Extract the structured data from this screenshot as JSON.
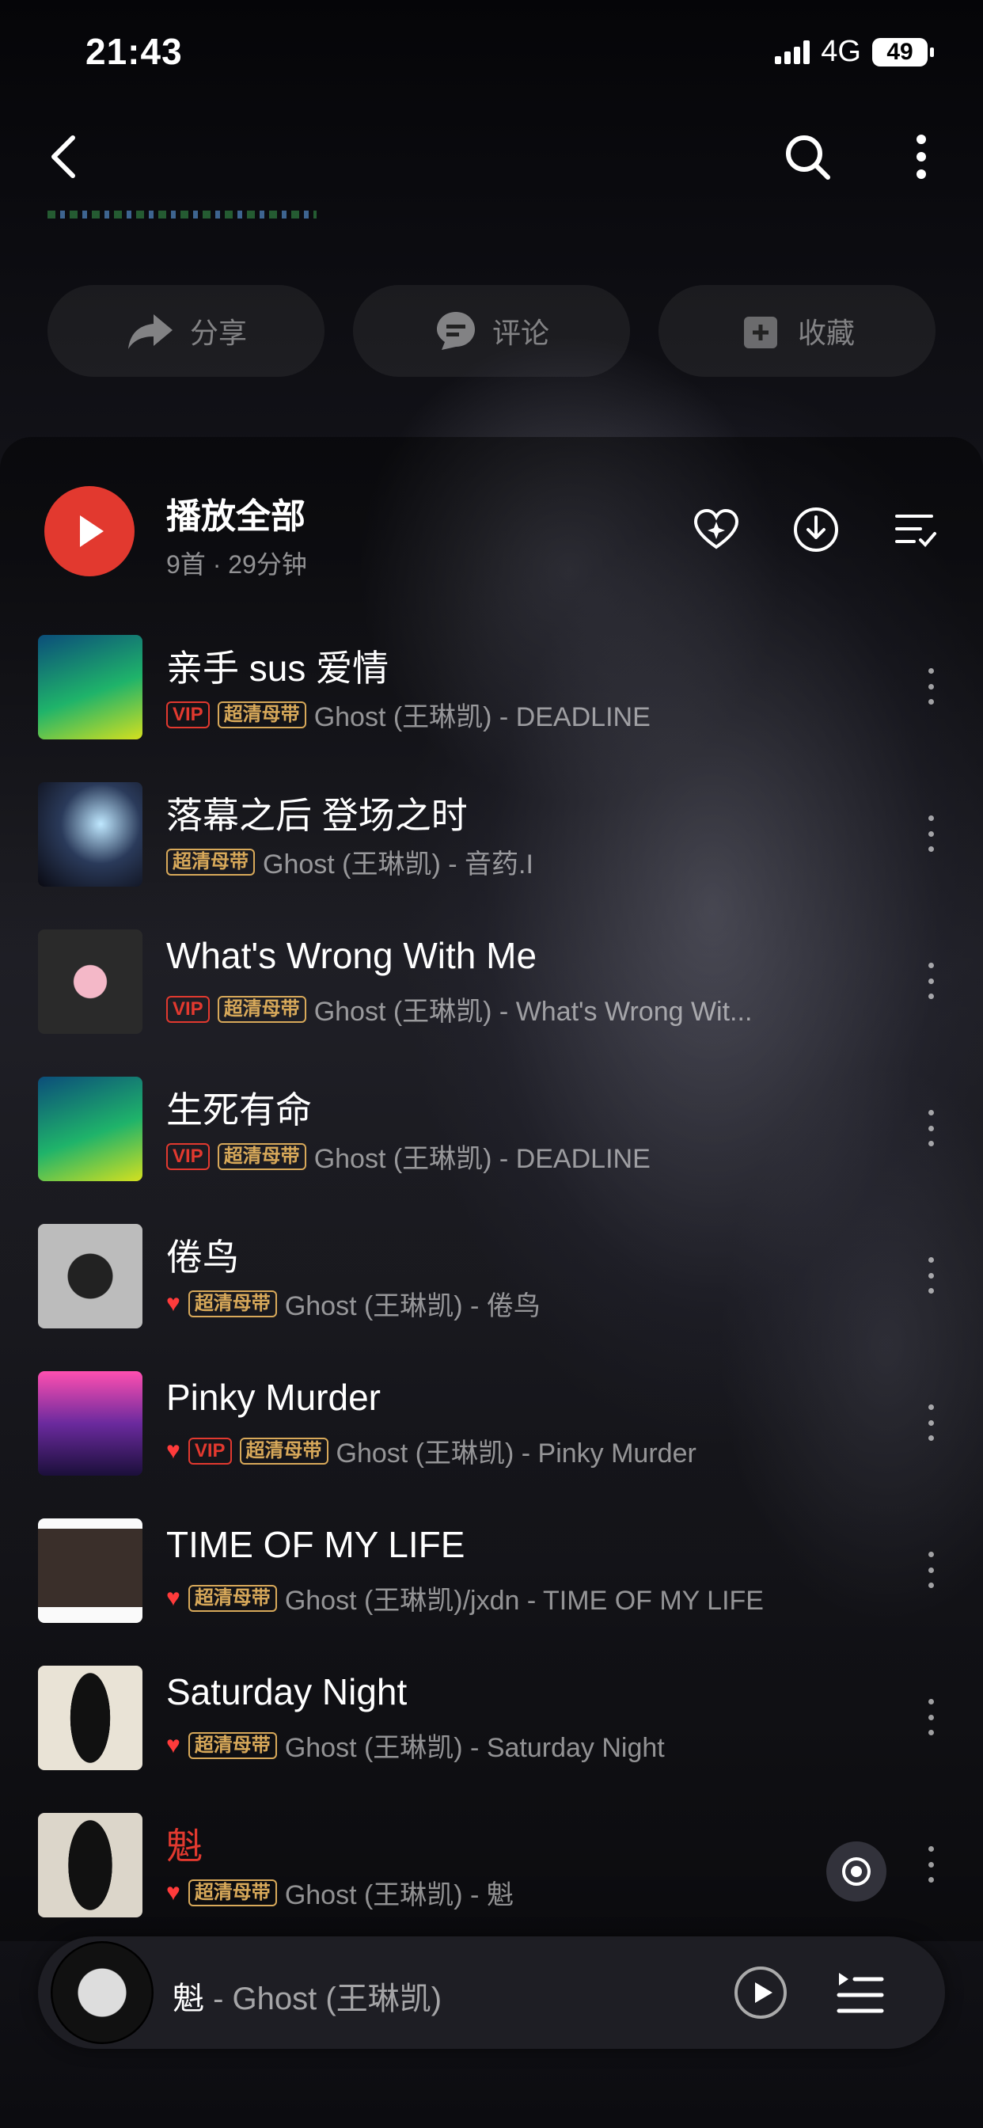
{
  "status": {
    "time": "21:43",
    "network": "4G",
    "battery": "49"
  },
  "nav": {
    "back_icon": "chevron-left-icon",
    "search_icon": "search-icon",
    "more_icon": "more-vertical-icon"
  },
  "actions": [
    {
      "label": "分享",
      "icon": "share-icon"
    },
    {
      "label": "评论",
      "icon": "comment-icon"
    },
    {
      "label": "收藏",
      "icon": "add-collection-icon"
    }
  ],
  "play_all": {
    "title": "播放全部",
    "subtitle": "9首 · 29分钟"
  },
  "songs": [
    {
      "title": "亲手 sus 爱情",
      "vip": "VIP",
      "hq": "超清母带",
      "liked": false,
      "meta": "Ghost (王琳凯) - DEADLINE"
    },
    {
      "title": "落幕之后 登场之时",
      "vip": "",
      "hq": "超清母带",
      "liked": false,
      "meta": "Ghost (王琳凯) - 音药.I"
    },
    {
      "title": "What's Wrong With Me",
      "vip": "VIP",
      "hq": "超清母带",
      "liked": false,
      "meta": "Ghost (王琳凯) - What's Wrong Wit..."
    },
    {
      "title": "生死有命",
      "vip": "VIP",
      "hq": "超清母带",
      "liked": false,
      "meta": "Ghost (王琳凯) - DEADLINE"
    },
    {
      "title": "倦鸟",
      "vip": "",
      "hq": "超清母带",
      "liked": true,
      "meta": "Ghost (王琳凯) - 倦鸟"
    },
    {
      "title": "Pinky Murder",
      "vip": "VIP",
      "hq": "超清母带",
      "liked": true,
      "meta": "Ghost (王琳凯) - Pinky Murder"
    },
    {
      "title": "TIME OF MY LIFE",
      "vip": "",
      "hq": "超清母带",
      "liked": true,
      "meta": "Ghost (王琳凯)/jxdn - TIME OF MY LIFE"
    },
    {
      "title": "Saturday Night",
      "vip": "",
      "hq": "超清母带",
      "liked": true,
      "meta": "Ghost (王琳凯) - Saturday Night"
    },
    {
      "title": "魁",
      "vip": "",
      "hq": "超清母带",
      "liked": true,
      "meta": "Ghost (王琳凯) - 魁",
      "playing": true
    }
  ],
  "mini_player": {
    "song": "魁",
    "artist": " - Ghost (王琳凯)"
  },
  "colors": {
    "accent": "#e2392f",
    "hq_badge": "#d8a95a",
    "heart": "#ff3b3b"
  }
}
